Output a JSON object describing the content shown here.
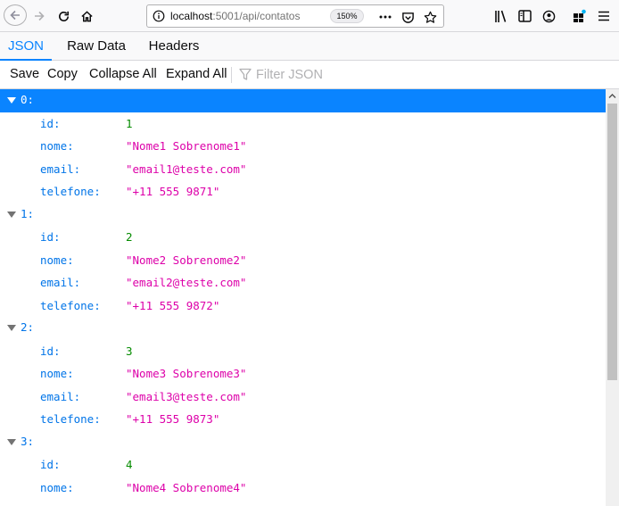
{
  "browser": {
    "url_host": "localhost",
    "url_rest": ":5001/api/contatos",
    "zoom": "150%"
  },
  "tabs": [
    {
      "label": "JSON",
      "active": true
    },
    {
      "label": "Raw Data",
      "active": false
    },
    {
      "label": "Headers",
      "active": false
    }
  ],
  "toolbar": {
    "save": "Save",
    "copy": "Copy",
    "collapse_all": "Collapse All",
    "expand_all": "Expand All",
    "filter_placeholder": "Filter JSON"
  },
  "colors": {
    "accent": "#0a84ff",
    "key": "#0074e8",
    "number": "#058b00",
    "string": "#dd00a9"
  },
  "contacts": [
    {
      "index": "0:",
      "id_key": "id:",
      "id": "1",
      "nome_key": "nome:",
      "nome": "\"Nome1 Sobrenome1\"",
      "email_key": "email:",
      "email": "\"email1@teste.com\"",
      "telefone_key": "telefone:",
      "telefone": "\"+11 555 9871\""
    },
    {
      "index": "1:",
      "id_key": "id:",
      "id": "2",
      "nome_key": "nome:",
      "nome": "\"Nome2 Sobrenome2\"",
      "email_key": "email:",
      "email": "\"email2@teste.com\"",
      "telefone_key": "telefone:",
      "telefone": "\"+11 555 9872\""
    },
    {
      "index": "2:",
      "id_key": "id:",
      "id": "3",
      "nome_key": "nome:",
      "nome": "\"Nome3 Sobrenome3\"",
      "email_key": "email:",
      "email": "\"email3@teste.com\"",
      "telefone_key": "telefone:",
      "telefone": "\"+11 555 9873\""
    },
    {
      "index": "3:",
      "id_key": "id:",
      "id": "4",
      "nome_key": "nome:",
      "nome": "\"Nome4 Sobrenome4\""
    }
  ]
}
